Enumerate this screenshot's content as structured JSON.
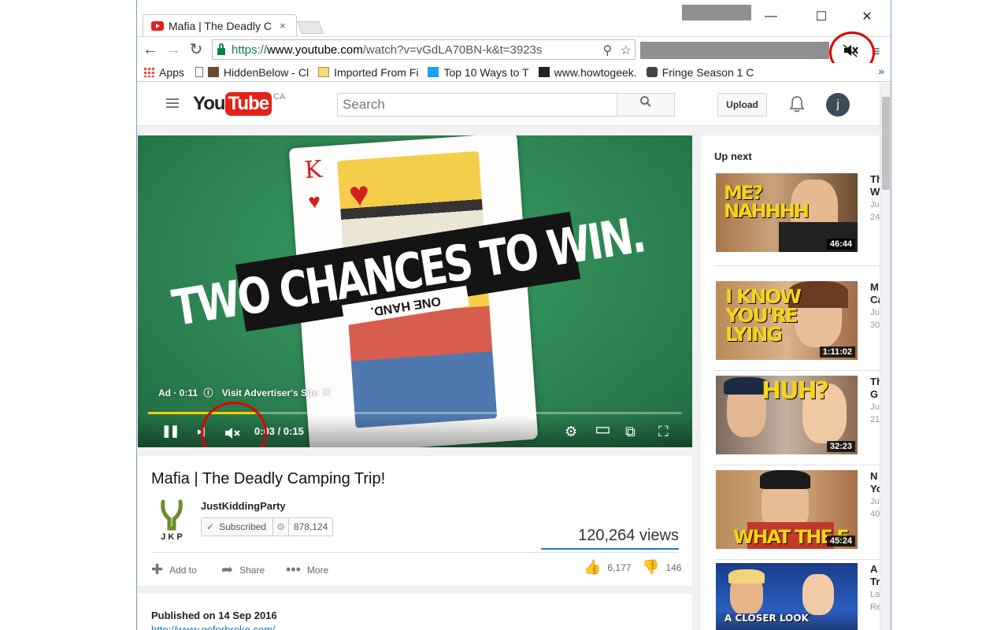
{
  "browser": {
    "tab_title": "Mafia | The Deadly C",
    "tab_close": "×",
    "window_controls": {
      "minimize": "—",
      "maximize": "☐",
      "close": "✕"
    },
    "nav": {
      "back": "←",
      "forward": "→",
      "reload": "↻"
    },
    "url": {
      "scheme": "https://",
      "host": "www.youtube.com",
      "path": "/watch?v=vGdLA70BN-k&t=3923s"
    },
    "zoom_icon": "⚲",
    "star_icon": "☆",
    "menu_icon": "≡",
    "bookmarks": [
      {
        "label": "Apps",
        "icon": "apps-grid-icon"
      },
      {
        "label": "HiddenBelow - Cl",
        "icon": "page-icon"
      },
      {
        "label": "Imported From Fi",
        "icon": "folder-icon"
      },
      {
        "label": "Top 10 Ways to T",
        "icon": "m-icon"
      },
      {
        "label": "www.howtogeek.",
        "icon": "htg-icon"
      },
      {
        "label": "Fringe Season 1 C",
        "icon": "car-icon"
      }
    ],
    "bookmarks_more": "»"
  },
  "youtube": {
    "logo_you": "You",
    "logo_tube": "Tube",
    "logo_country": "CA",
    "search_placeholder": "Search",
    "search_button": "⚲",
    "upload_label": "Upload",
    "avatar_letter": "j",
    "player": {
      "banner_text": "TWO CHANCES TO WIN.",
      "band_text": "ONE HAND.",
      "card_rank": "K",
      "ad_label": "Ad · 0:11",
      "ad_info_icon": "ⓘ",
      "visit_label": "Visit Advertiser's Site",
      "visit_icon": "⇱",
      "time": "0:03 / 0:15",
      "progress": 0.2,
      "icons": {
        "pause": "❚❚",
        "next": "▸|",
        "mute": "🔇",
        "settings": "⚙",
        "theater": "▭",
        "cast": "⧉",
        "fullscreen": "⛶"
      }
    },
    "video_title": "Mafia | The Deadly Camping Trip!",
    "channel_name": "JustKiddingParty",
    "subscribed_label": "Subscribed",
    "subscriber_count": "878,124",
    "views": "120,264 views",
    "actions": {
      "add_to": "Add to",
      "share": "Share",
      "more": "More"
    },
    "likes": "6,177",
    "dislikes": "146",
    "published": "Published on 14 Sep 2016",
    "description_link": "http://www.goforbroke.com/",
    "up_next_label": "Up next",
    "sidebar": [
      {
        "thumb_text": "ME?\nNAHHHH",
        "duration": "46:44",
        "title": "Th",
        "title2": "W",
        "meta": "Ju",
        "meta2": "24"
      },
      {
        "thumb_text": "I KNOW\nYOU'RE\nLYING",
        "duration": "1:11:02",
        "title": "M",
        "title2": "Ca",
        "meta": "Ju",
        "meta2": "30"
      },
      {
        "thumb_text": "HUH?",
        "duration": "32:23",
        "title": "Th",
        "title2": "G",
        "meta": "Ju",
        "meta2": "21"
      },
      {
        "thumb_text": "WHAT THE F",
        "duration": "45:24",
        "title": "N",
        "title2": "Yo",
        "meta": "Ju",
        "meta2": "40"
      },
      {
        "thumb_text": "A CLOSER LOOK",
        "duration": "",
        "title": "A",
        "title2": "Tr",
        "meta": "La",
        "meta2": "Re"
      }
    ]
  },
  "colors": {
    "youtube_red": "#e62117",
    "annotation_red": "#e00000",
    "progress_yellow": "#ffcc00",
    "link_blue": "#167ac6"
  }
}
